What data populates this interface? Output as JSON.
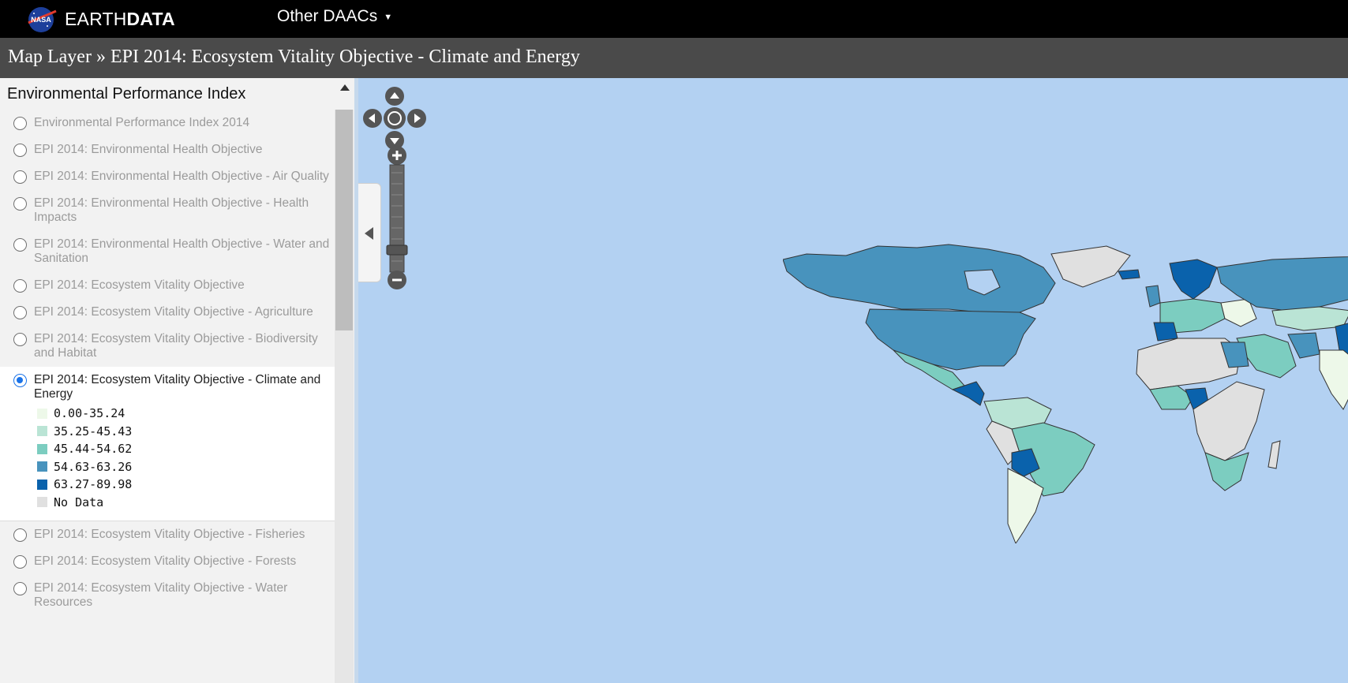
{
  "header": {
    "brand_regular": "EARTH",
    "brand_bold": "DATA",
    "nav_label": "Other DAACs",
    "logo_text": "NASA"
  },
  "title_bar": {
    "prefix": "Map Layer",
    "separator": " » ",
    "layer_title": "EPI 2014: Ecosystem Vitality Objective - Climate and Energy"
  },
  "sidebar": {
    "heading": "Environmental Performance Index",
    "layers": [
      {
        "label": "Environmental Performance Index 2014",
        "selected": false
      },
      {
        "label": "EPI 2014: Environmental Health Objective",
        "selected": false
      },
      {
        "label": "EPI 2014: Environmental Health Objective - Air Quality",
        "selected": false
      },
      {
        "label": "EPI 2014: Environmental Health Objective - Health Impacts",
        "selected": false
      },
      {
        "label": "EPI 2014: Environmental Health Objective - Water and Sanitation",
        "selected": false
      },
      {
        "label": "EPI 2014: Ecosystem Vitality Objective",
        "selected": false
      },
      {
        "label": "EPI 2014: Ecosystem Vitality Objective - Agriculture",
        "selected": false
      },
      {
        "label": "EPI 2014: Ecosystem Vitality Objective - Biodiversity and Habitat",
        "selected": false
      },
      {
        "label": "EPI 2014: Ecosystem Vitality Objective - Climate and Energy",
        "selected": true
      },
      {
        "label": "EPI 2014: Ecosystem Vitality Objective - Fisheries",
        "selected": false
      },
      {
        "label": "EPI 2014: Ecosystem Vitality Objective - Forests",
        "selected": false
      },
      {
        "label": "EPI 2014: Ecosystem Vitality Objective - Water Resources",
        "selected": false
      }
    ],
    "legend": [
      {
        "label": "0.00-35.24",
        "color": "#edf8e9"
      },
      {
        "label": "35.25-45.43",
        "color": "#bae4d5"
      },
      {
        "label": "45.44-54.62",
        "color": "#7ccdc0"
      },
      {
        "label": "54.63-63.26",
        "color": "#4893bd"
      },
      {
        "label": "63.27-89.98",
        "color": "#0a62ac"
      },
      {
        "label": "No Data",
        "color": "#e0e0e0"
      }
    ]
  },
  "map": {
    "ocean_color": "#b3d1f2",
    "pan_icon": "pan-control-icon",
    "zoom_in_icon": "zoom-in-icon",
    "zoom_out_icon": "zoom-out-icon",
    "collapse_icon": "chevron-left-icon"
  }
}
